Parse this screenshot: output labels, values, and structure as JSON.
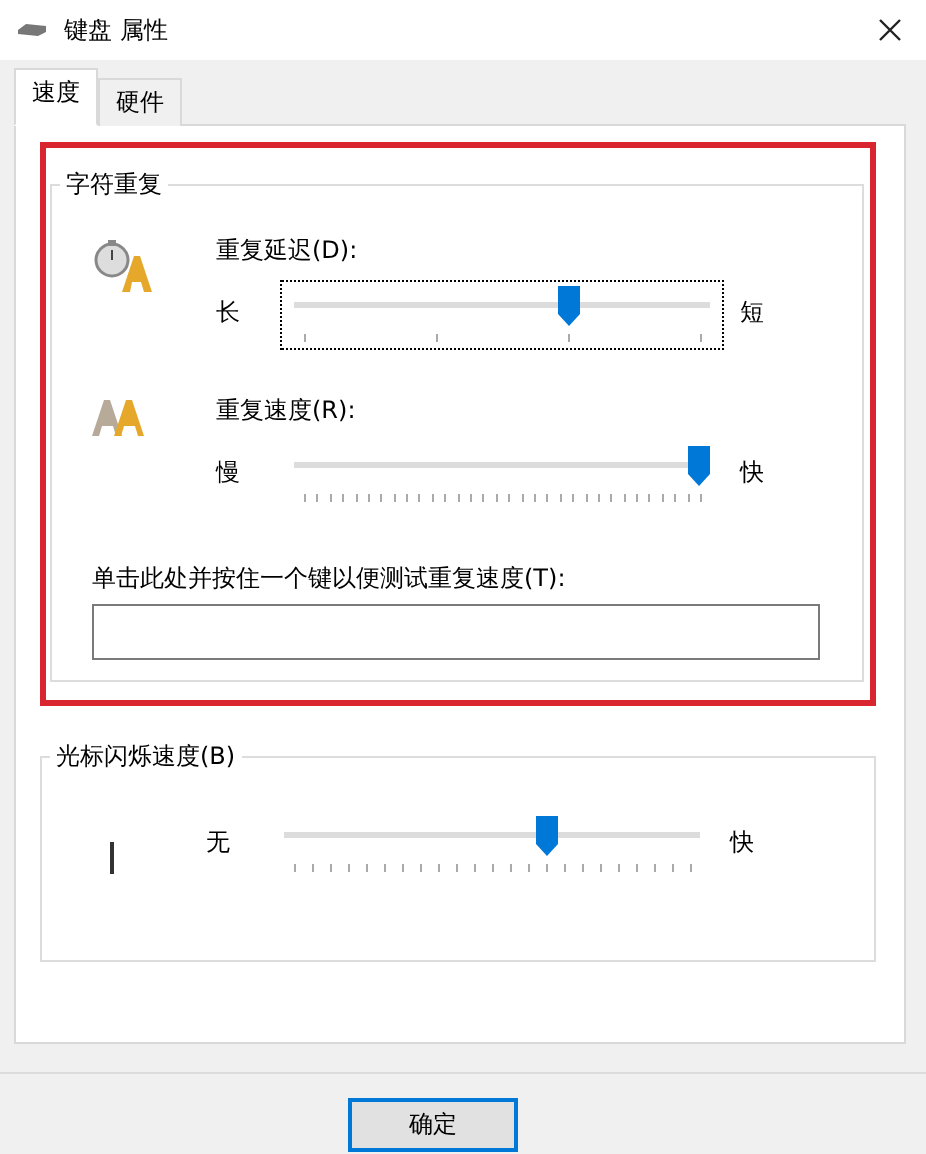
{
  "window": {
    "title": "键盘 属性"
  },
  "tabs": [
    {
      "label": "速度",
      "selected": true
    },
    {
      "label": "硬件",
      "selected": false
    }
  ],
  "repeat_group": {
    "title": "字符重复",
    "highlighted": true,
    "sliders": [
      {
        "kind": "delay",
        "label": "重复延迟(D):",
        "min_label": "长",
        "max_label": "短",
        "level": 0.67,
        "focused": true
      },
      {
        "kind": "rate",
        "label": "重复速度(R):",
        "min_label": "慢",
        "max_label": "快",
        "level": 1,
        "focused": false
      }
    ],
    "test_field": {
      "label": "单击此处并按住一个键以便测试重复速度(T):"
    }
  },
  "blink_group": {
    "title": "光标闪烁速度(B)",
    "slider": {
      "kind": "blink",
      "min_label": "无",
      "max_label": "快",
      "level": 0.64,
      "focused": false
    }
  },
  "buttons": [
    {
      "label": "确定",
      "default": true
    }
  ]
}
